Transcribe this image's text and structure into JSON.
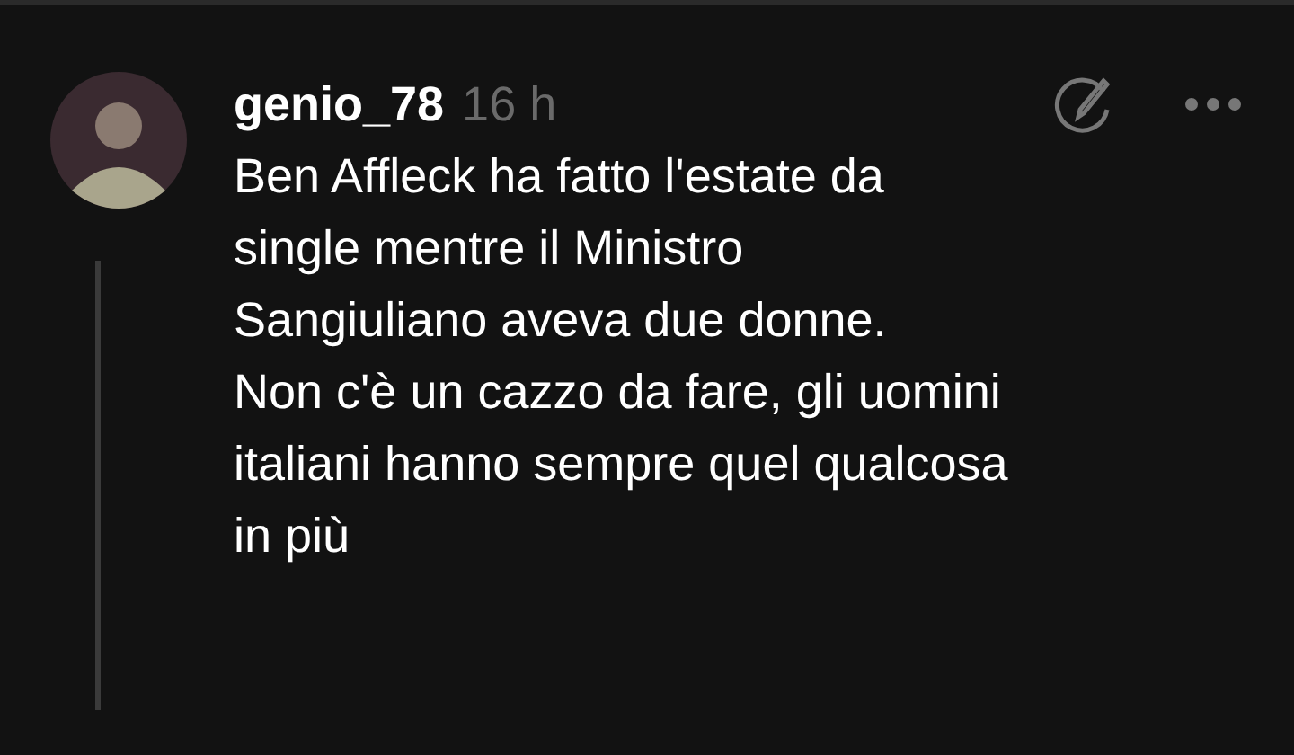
{
  "comment": {
    "author": "genio_78",
    "time": "16 h",
    "lines": [
      "Ben Affleck ha fatto l'estate da",
      "single mentre il Ministro",
      "Sangiuliano aveva due donne.",
      "Non c'è un cazzo da fare, gli uomini",
      "italiani hanno sempre quel qualcosa",
      "in più"
    ]
  }
}
